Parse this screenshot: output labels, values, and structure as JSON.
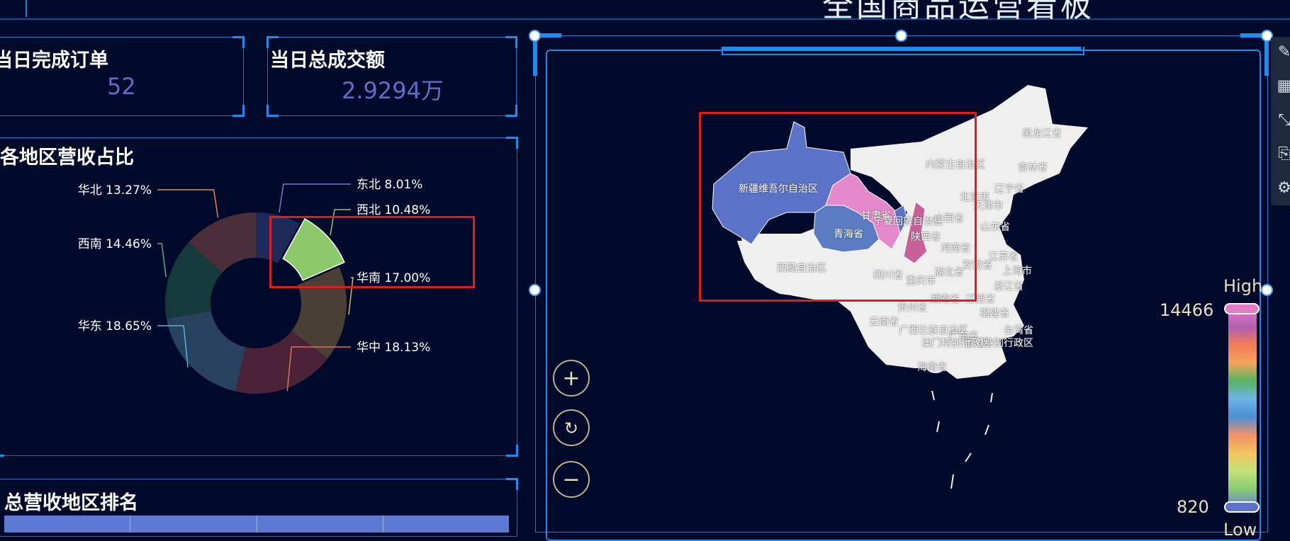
{
  "page": {
    "title": "全国商品运营看板"
  },
  "stats": [
    {
      "label": "当日完成订单",
      "value": "52"
    },
    {
      "label": "当日总成交额",
      "value": "2.9294万"
    }
  ],
  "pie_panel": {
    "title": "各地区营收占比"
  },
  "ranking_panel": {
    "title": "总营收地区排名"
  },
  "chart_data": {
    "type": "pie",
    "title": "各地区营收占比",
    "categories": [
      "东北",
      "西北",
      "华南",
      "华中",
      "华东",
      "西南",
      "华北"
    ],
    "values": [
      8.01,
      10.48,
      17.0,
      18.13,
      18.65,
      14.46,
      13.27
    ],
    "labels": [
      "东北 8.01%",
      "西北 10.48%",
      "华南 17.00%",
      "华中 18.13%",
      "华东 18.65%",
      "西南 14.46%",
      "华北 13.27%"
    ],
    "colors": [
      "#1e2b5a",
      "#8cc96b",
      "#4a3f36",
      "#4a2337",
      "#27415f",
      "#163a3c",
      "#4a2e39"
    ],
    "highlighted": "西北"
  },
  "map": {
    "visualmap": {
      "high_label": "High",
      "low_label": "Low",
      "max": "14466",
      "min": "820"
    },
    "provinces": [
      "黑龙江省",
      "内蒙古自治区",
      "吉林省",
      "辽宁省",
      "新疆维吾尔自治区",
      "甘肃省",
      "宁夏回族自治区",
      "山西省",
      "北京市",
      "天津市",
      "青海省",
      "陕西省",
      "河南省",
      "山东省",
      "江苏省",
      "西藏自治区",
      "四川省",
      "湖北省",
      "安徽省",
      "上海市",
      "重庆市",
      "浙江省",
      "湖南省",
      "江西省",
      "贵州省",
      "福建省",
      "云南省",
      "广西壮族自治区",
      "台湾省",
      "广东省",
      "香港特别行政区",
      "澳门特别行政区",
      "海南省"
    ],
    "zoom_in": "+",
    "reset": "↻",
    "zoom_out": "−"
  },
  "toolbox": {
    "icons": [
      "edit-icon",
      "data-view-icon",
      "restore-icon",
      "save-icon",
      "settings-icon"
    ]
  }
}
